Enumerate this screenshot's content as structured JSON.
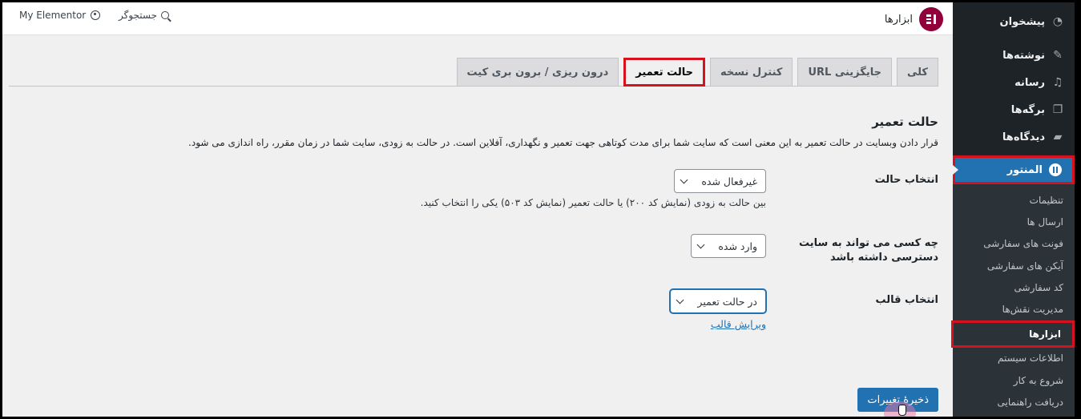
{
  "topbar": {
    "title": "ابزارها",
    "search_label": "جستجوگر",
    "my_elementor": "My Elementor"
  },
  "sidebar": {
    "items": [
      {
        "label": "پیشخوان",
        "icon": "dashboard-icon"
      },
      {
        "label": "نوشته‌ها",
        "icon": "pin-icon"
      },
      {
        "label": "رسانه",
        "icon": "media-icon"
      },
      {
        "label": "برگه‌ها",
        "icon": "pages-icon"
      },
      {
        "label": "دیدگاه‌ها",
        "icon": "comments-icon"
      }
    ],
    "active": {
      "label": "المنتور",
      "icon": "elementor-icon"
    },
    "submenu": [
      "تنظیمات",
      "ارسال ها",
      "فونت های سفارشی",
      "آیکن های سفارشی",
      "کد سفارشی",
      "مدیریت نقش‌ها",
      "ابزارها",
      "اطلاعات سیستم",
      "شروع به کار",
      "دریافت راهنمایی"
    ],
    "current_submenu": "ابزارها"
  },
  "tabs": [
    "کلی",
    "جایگزینی URL",
    "کنترل نسخه",
    "حالت تعمیر",
    "درون ریزی / برون بری کیت"
  ],
  "active_tab": "حالت تعمیر",
  "content": {
    "heading": "حالت تعمیر",
    "description": "قرار دادن وبسایت در حالت تعمیر به این معنی است که سایت شما برای مدت کوتاهی جهت تعمیر و نگهداری، آفلاین است. در حالت به زودی، سایت شما در زمان مقرر، راه اندازی می شود.",
    "mode": {
      "label": "انتخاب حالت",
      "value": "غیرفعال شده",
      "help": "بین حالت به زودی (نمایش کد ۲۰۰) یا حالت تعمیر (نمایش کد ۵۰۳) یکی را انتخاب کنید."
    },
    "access": {
      "label": "چه کسی می تواند به سایت دسترسی داشته باشد",
      "value": "وارد شده"
    },
    "template": {
      "label": "انتخاب قالب",
      "value": "در حالت تعمیر",
      "edit_link": "ویرایش قالب"
    },
    "save_button": "ذخیرهٔ تغییرات"
  },
  "colors": {
    "accent": "#2271b1",
    "sidebar_bg": "#1d2327",
    "highlight": "#d6121f",
    "elementor": "#92003b"
  }
}
